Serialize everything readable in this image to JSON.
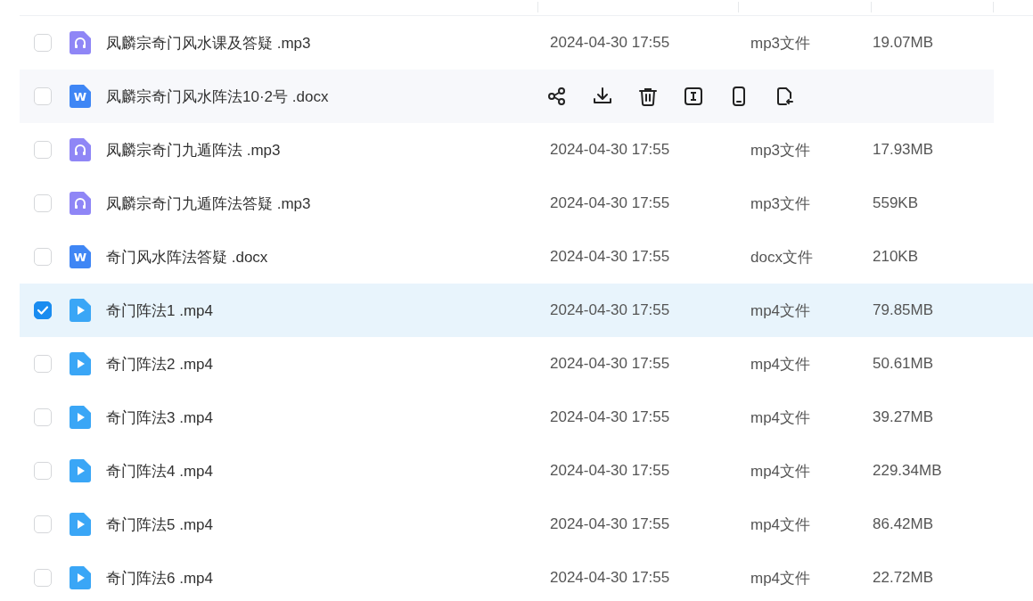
{
  "files": [
    {
      "kind": "mp3",
      "name": "凤麟宗奇门风水课及答疑 .mp3",
      "modified": "2024-04-30 17:55",
      "type": "mp3文件",
      "size": "19.07MB",
      "checked": false,
      "hovered": false
    },
    {
      "kind": "docx",
      "badge": "W",
      "name": "凤麟宗奇门风水阵法10·2号 .docx",
      "checked": false,
      "hovered": true
    },
    {
      "kind": "mp3",
      "name": "凤麟宗奇门九遁阵法 .mp3",
      "modified": "2024-04-30 17:55",
      "type": "mp3文件",
      "size": "17.93MB",
      "checked": false,
      "hovered": false
    },
    {
      "kind": "mp3",
      "name": "凤麟宗奇门九遁阵法答疑 .mp3",
      "modified": "2024-04-30 17:55",
      "type": "mp3文件",
      "size": "559KB",
      "checked": false,
      "hovered": false
    },
    {
      "kind": "docx",
      "badge": "W",
      "name": "奇门风水阵法答疑 .docx",
      "modified": "2024-04-30 17:55",
      "type": "docx文件",
      "size": "210KB",
      "checked": false,
      "hovered": false
    },
    {
      "kind": "mp4",
      "name": "奇门阵法1 .mp4",
      "modified": "2024-04-30 17:55",
      "type": "mp4文件",
      "size": "79.85MB",
      "checked": true,
      "hovered": false
    },
    {
      "kind": "mp4",
      "name": "奇门阵法2 .mp4",
      "modified": "2024-04-30 17:55",
      "type": "mp4文件",
      "size": "50.61MB",
      "checked": false,
      "hovered": false
    },
    {
      "kind": "mp4",
      "name": "奇门阵法3 .mp4",
      "modified": "2024-04-30 17:55",
      "type": "mp4文件",
      "size": "39.27MB",
      "checked": false,
      "hovered": false
    },
    {
      "kind": "mp4",
      "name": "奇门阵法4 .mp4",
      "modified": "2024-04-30 17:55",
      "type": "mp4文件",
      "size": "229.34MB",
      "checked": false,
      "hovered": false
    },
    {
      "kind": "mp4",
      "name": "奇门阵法5 .mp4",
      "modified": "2024-04-30 17:55",
      "type": "mp4文件",
      "size": "86.42MB",
      "checked": false,
      "hovered": false
    },
    {
      "kind": "mp4",
      "name": "奇门阵法6 .mp4",
      "modified": "2024-04-30 17:55",
      "type": "mp4文件",
      "size": "22.72MB",
      "checked": false,
      "hovered": false
    }
  ]
}
